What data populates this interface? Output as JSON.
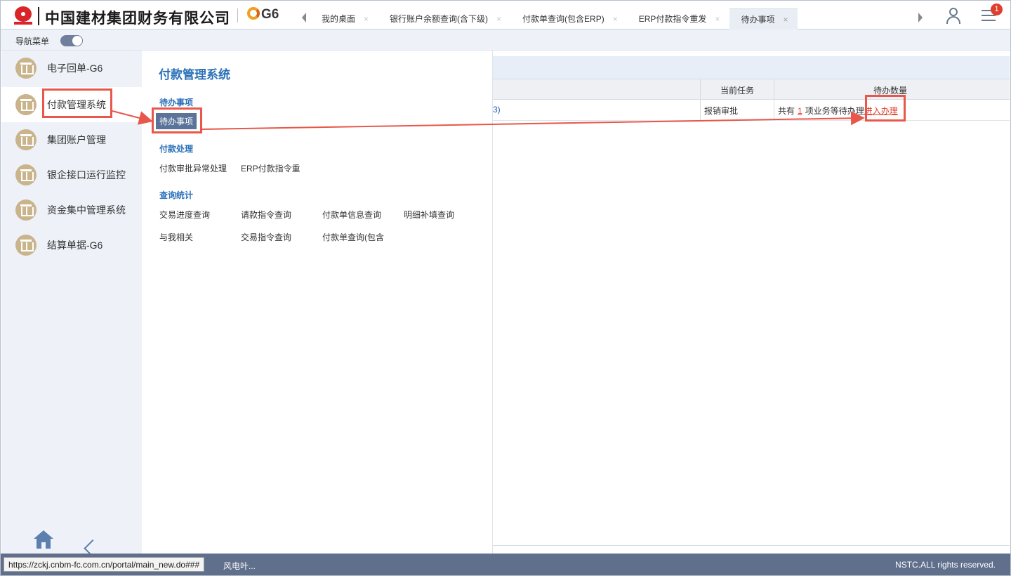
{
  "header": {
    "company_name": "中国建材集团财务有限公司",
    "product_logo": "G6",
    "tabs": [
      {
        "label": "我的桌面",
        "active": false
      },
      {
        "label": "银行账户余额查询(含下级)",
        "active": false
      },
      {
        "label": "付款单查询(包含ERP)",
        "active": false
      },
      {
        "label": "ERP付款指令重发",
        "active": false
      },
      {
        "label": "待办事项",
        "active": true
      }
    ],
    "tab_close_glyph": "×",
    "notification_count": "1",
    "icons": [
      "company-logo-icon",
      "tab-scroll-left-icon",
      "tab-scroll-right-icon",
      "user-icon",
      "menu-icon"
    ]
  },
  "subbar": {
    "nav_menu_label": "导航菜单",
    "nav_menu_toggle_on": true
  },
  "sidebar": {
    "items": [
      {
        "label": "电子回单-G6",
        "active": false
      },
      {
        "label": "付款管理系统",
        "active": true
      },
      {
        "label": "集团账户管理",
        "active": false
      },
      {
        "label": "银企接口运行监控",
        "active": false
      },
      {
        "label": "资金集中管理系统",
        "active": false
      },
      {
        "label": "结算单据-G6",
        "active": false
      }
    ],
    "item_icon": "bank-icon",
    "bottom_icons": [
      "home-icon",
      "collapse-left-icon"
    ]
  },
  "flyout": {
    "title": "付款管理系统",
    "sections": [
      {
        "title": "待办事项",
        "links": [
          "待办事项"
        ]
      },
      {
        "title": "付款处理",
        "links": [
          "付款审批异常处理",
          "ERP付款指令重"
        ]
      },
      {
        "title": "查询统计",
        "links": [
          "交易进度查询",
          "请款指令查询",
          "付款单信息查询",
          "明细补填查询",
          "与我相关",
          "交易指令查询",
          "付款单查询(包含"
        ]
      }
    ],
    "selected_link": "待办事项"
  },
  "main": {
    "table": {
      "headers": [
        "当前任务",
        "待办数量"
      ],
      "rows": [
        {
          "name_fragment": "3)",
          "current_task": "报销审批",
          "pending_prefix": "共有",
          "pending_count": "1",
          "pending_suffix": "项业务等待办理",
          "action_link": "进入办理"
        }
      ]
    }
  },
  "footer": {
    "ticker_text": "风电叶...",
    "copyright": "NSTC.ALL rights reserved."
  },
  "status_bar": {
    "url": "https://zckj.cnbm-fc.com.cn/portal/main_new.do###"
  },
  "colors": {
    "accent_blue": "#2a70b8",
    "annotation_red": "#e8574a",
    "footer_bg": "#5f6f8c",
    "selected_link_bg": "#5a7398",
    "sidebar_icon_gold": "#c9b48c"
  }
}
